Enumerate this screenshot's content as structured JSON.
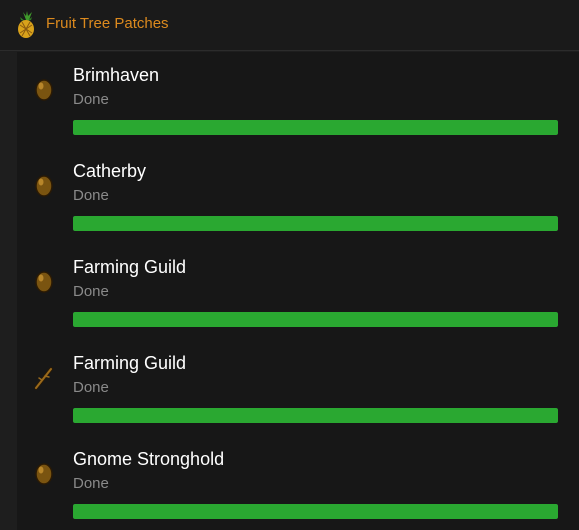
{
  "header": {
    "title": "Fruit Tree Patches",
    "icon": "pineapple-icon"
  },
  "colors": {
    "accent": "#dc8a1e",
    "progress": "#2aa831",
    "status_text": "#8a8a8a"
  },
  "items": [
    {
      "name": "Brimhaven",
      "status": "Done",
      "icon": "seed-icon",
      "progress": 1.0
    },
    {
      "name": "Catherby",
      "status": "Done",
      "icon": "seed-icon",
      "progress": 1.0
    },
    {
      "name": "Farming Guild",
      "status": "Done",
      "icon": "seed-icon",
      "progress": 1.0
    },
    {
      "name": "Farming Guild",
      "status": "Done",
      "icon": "sapling-stick-icon",
      "progress": 1.0
    },
    {
      "name": "Gnome Stronghold",
      "status": "Done",
      "icon": "seed-icon",
      "progress": 1.0
    }
  ]
}
